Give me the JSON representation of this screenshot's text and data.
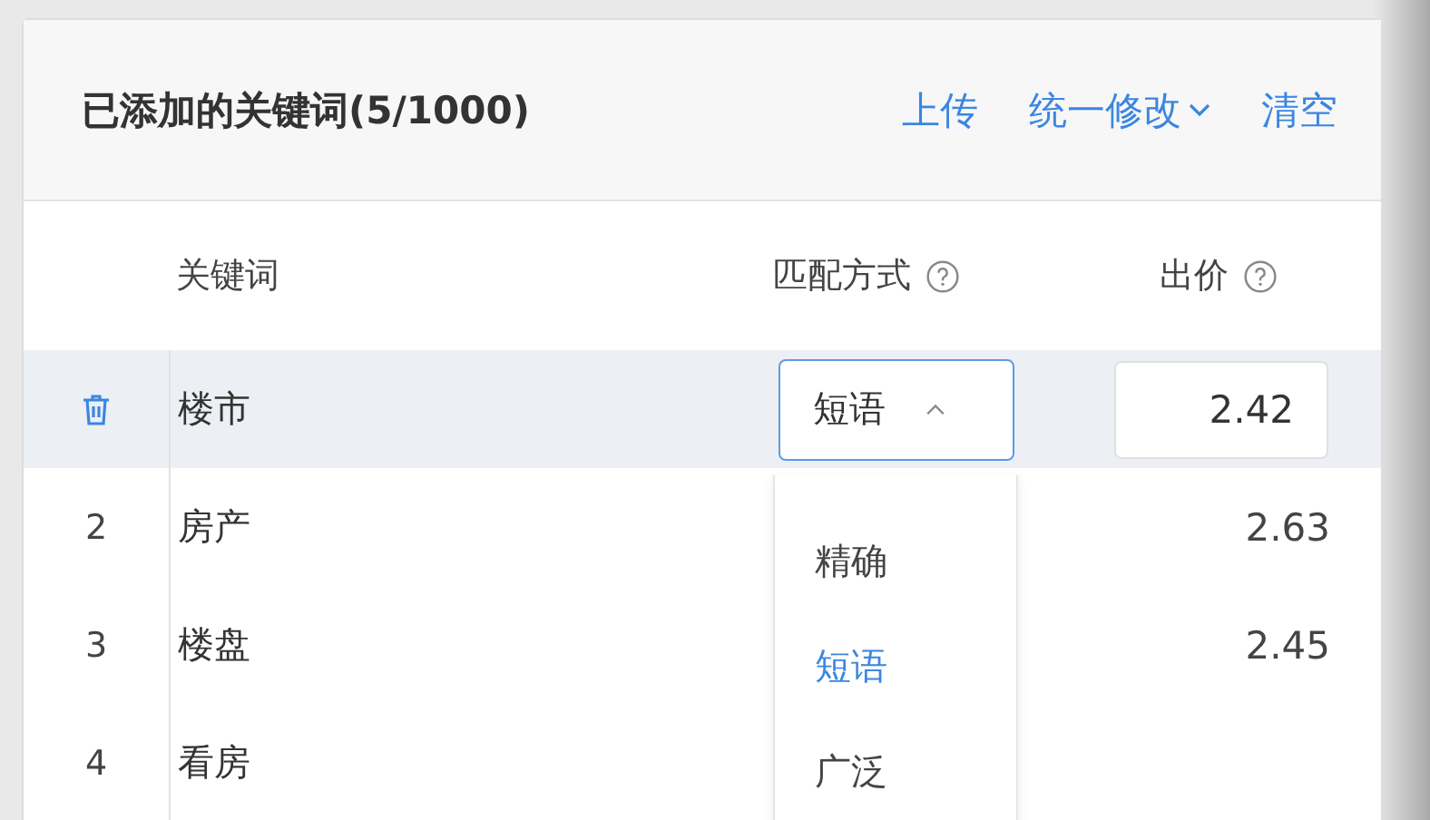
{
  "panel": {
    "title": "已添加的关键词(5/1000)",
    "actions": [
      {
        "label": "上传",
        "kind": "link"
      },
      {
        "label": "统一修改",
        "kind": "menu"
      },
      {
        "label": "清空",
        "kind": "link"
      }
    ]
  },
  "table": {
    "columns": [
      {
        "label": "关键词",
        "help": false
      },
      {
        "label": "匹配方式",
        "help": true
      },
      {
        "label": "出价",
        "help": true
      }
    ],
    "rows": [
      {
        "keyword": "楼市",
        "match": "短语",
        "price": "2.42",
        "hovered": true,
        "expanded": true
      },
      {
        "index": "2",
        "keyword": "房产",
        "price": "2.63",
        "hovered": false
      },
      {
        "index": "3",
        "keyword": "楼盘",
        "price": "2.45",
        "hovered": false
      },
      {
        "index": "4",
        "keyword": "看房",
        "hovered": false
      }
    ]
  },
  "dropdown": {
    "options": [
      {
        "label": "精确",
        "selected": false
      },
      {
        "label": "短语",
        "selected": true
      },
      {
        "label": "广泛",
        "selected": false
      }
    ]
  }
}
